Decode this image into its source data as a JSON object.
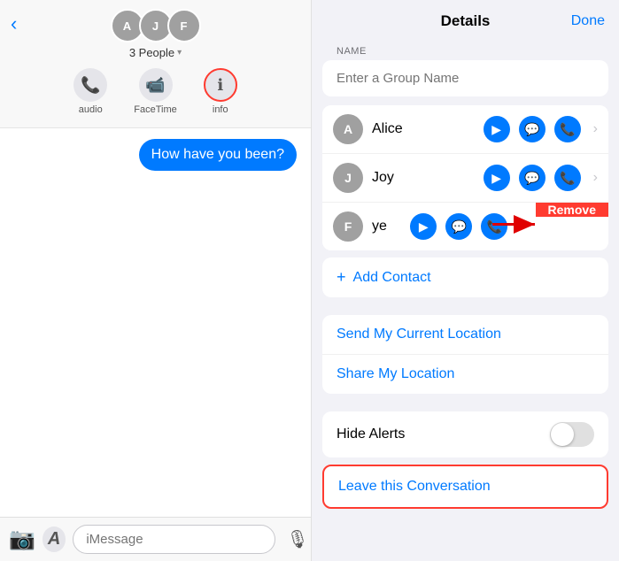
{
  "left": {
    "back_icon": "‹",
    "avatar_initials": [
      "A",
      "J",
      "F"
    ],
    "people_label": "3 People",
    "actions": [
      {
        "id": "audio",
        "icon": "📞",
        "label": "audio"
      },
      {
        "id": "facetime",
        "icon": "📹",
        "label": "FaceTime"
      },
      {
        "id": "info",
        "icon": "ℹ",
        "label": "info"
      }
    ],
    "message": "How have you been?",
    "input_placeholder": "iMessage",
    "bottom_icons": [
      "📷",
      "🅐"
    ]
  },
  "right": {
    "title": "Details",
    "done_label": "Done",
    "name_section_label": "NAME",
    "group_name_placeholder": "Enter a Group Name",
    "contacts": [
      {
        "initial": "A",
        "name": "Alice"
      },
      {
        "initial": "J",
        "name": "Joy"
      },
      {
        "initial": "F",
        "name": "ye",
        "partial": true
      }
    ],
    "add_contact_label": "Add Contact",
    "location_options": [
      "Send My Current Location",
      "Share My Location"
    ],
    "hide_alerts_label": "Hide Alerts",
    "leave_label": "Leave this Conversation",
    "remove_label": "Remove"
  }
}
